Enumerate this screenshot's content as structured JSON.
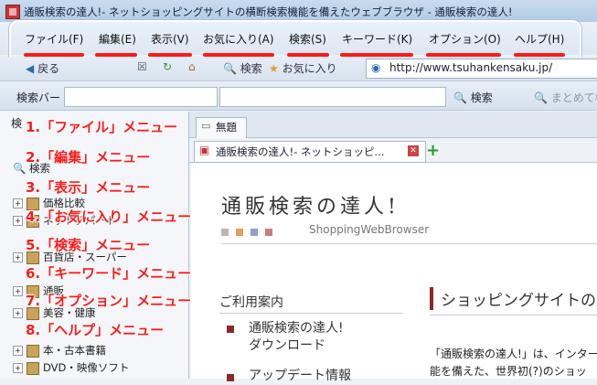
{
  "window": {
    "title": "通販検索の達人!- ネットショッピングサイトの横断検索機能を備えたウェブブラウザ - 通販検索の達人!"
  },
  "menu": {
    "items": [
      {
        "label": "ファイル(F)",
        "num": "1"
      },
      {
        "label": "編集(E)",
        "num": "2"
      },
      {
        "label": "表示(V)",
        "num": "3"
      },
      {
        "label": "お気に入り(A)",
        "num": "4"
      },
      {
        "label": "検索(S)",
        "num": "5"
      },
      {
        "label": "キーワード(K)",
        "num": "6"
      },
      {
        "label": "オプション(O)",
        "num": "7"
      },
      {
        "label": "ヘルプ(H)",
        "num": "8"
      }
    ]
  },
  "navbar": {
    "back": "戻る",
    "search": "検索",
    "favorites": "お気に入り",
    "url": "http://www.tsuhankensaku.jp/"
  },
  "searchbar": {
    "label": "検索バー",
    "search_button": "検索",
    "search_all": "まとめて検索"
  },
  "left_panel": {
    "header": "検",
    "root": "検索",
    "items": [
      "価格比較",
      "ネットデパート",
      "百貨店・スーパー",
      "通販",
      "美容・健康",
      "本・古本書籍",
      "DVD・映像ソフト"
    ]
  },
  "tabs": {
    "untitled": "無題",
    "page": "通販検索の達人!- ネットショッピ..."
  },
  "content": {
    "site_title": "通販検索の達人!",
    "site_subtitle": "ShoppingWebBrowser",
    "guide_heading": "ご利用案内",
    "guide_links": [
      "通販検索の達人!\nダウンロード",
      "アップデート情報"
    ],
    "shop_heading": "ショッピングサイトの",
    "shop_body_1": "「通販検索の達人!」は、インター",
    "shop_body_2": "能を備えた、世界初(?)のショッ"
  },
  "annotations": [
    "1.「ファイル」メニュー",
    "2.「編集」メニュー",
    "3.「表示」メニュー",
    "4.「お気に入り」メニュー",
    "5.「検索」メニュー",
    "6.「キーワード」メニュー",
    "7.「オプション」メニュー",
    "8.「ヘルプ」メニュー"
  ],
  "colors": {
    "annotation_red": "#ff1a1a",
    "accent_maroon": "#8a2a2a"
  }
}
